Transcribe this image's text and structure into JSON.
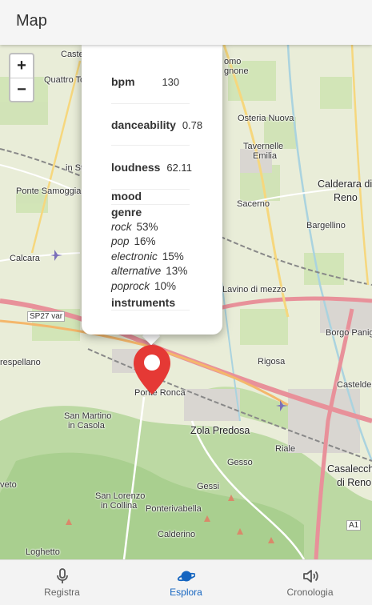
{
  "app_bar": {
    "title": "Map"
  },
  "map": {
    "zoom_in": "+",
    "zoom_out": "−",
    "places": [
      {
        "name": "Castel",
        "cls": ""
      },
      {
        "name": "Quattro To",
        "cls": ""
      },
      {
        "name": "in St",
        "cls": ""
      },
      {
        "name": "Ponte Samoggia",
        "cls": ""
      },
      {
        "name": "Calcara",
        "cls": ""
      },
      {
        "name": "SP27 var",
        "cls": ""
      },
      {
        "name": "respellano",
        "cls": ""
      },
      {
        "name": "Ponte Ronca",
        "cls": ""
      },
      {
        "name": "San Martino",
        "cls": ""
      },
      {
        "name": "in Casola",
        "cls": ""
      },
      {
        "name": "veto",
        "cls": ""
      },
      {
        "name": "San Lorenzo",
        "cls": ""
      },
      {
        "name": "in Collina",
        "cls": ""
      },
      {
        "name": "Ponterivabella",
        "cls": ""
      },
      {
        "name": "Calderino",
        "cls": ""
      },
      {
        "name": "Loghetto",
        "cls": ""
      },
      {
        "name": "Zola Predosa",
        "cls": "big"
      },
      {
        "name": "Gesso",
        "cls": ""
      },
      {
        "name": "Gessi",
        "cls": ""
      },
      {
        "name": "Riale",
        "cls": ""
      },
      {
        "name": "Casalecch",
        "cls": "big"
      },
      {
        "name": "di Reno",
        "cls": "big"
      },
      {
        "name": "A1",
        "cls": ""
      },
      {
        "name": "Rigosa",
        "cls": ""
      },
      {
        "name": "Lavino di mezzo",
        "cls": ""
      },
      {
        "name": "Sacerno",
        "cls": ""
      },
      {
        "name": "Tavernelle",
        "cls": ""
      },
      {
        "name": "Emilia",
        "cls": ""
      },
      {
        "name": "Osteria Nuova",
        "cls": ""
      },
      {
        "name": "omo",
        "cls": ""
      },
      {
        "name": "gnone",
        "cls": ""
      },
      {
        "name": "Calderara di",
        "cls": "big"
      },
      {
        "name": "Reno",
        "cls": "big"
      },
      {
        "name": "Bargellino",
        "cls": ""
      },
      {
        "name": "Borgo Panig",
        "cls": ""
      },
      {
        "name": "Casteldel",
        "cls": ""
      }
    ]
  },
  "popup": {
    "bpm": {
      "label": "bpm",
      "value": "130"
    },
    "danceability": {
      "label": "danceability",
      "value": "0.78"
    },
    "loudness": {
      "label": "loudness",
      "value": "62.11"
    },
    "mood": {
      "label": "mood"
    },
    "genre": {
      "label": "genre",
      "items": [
        {
          "name": "rock",
          "pct": "53%"
        },
        {
          "name": "pop",
          "pct": "16%"
        },
        {
          "name": "electronic",
          "pct": "15%"
        },
        {
          "name": "alternative",
          "pct": "13%"
        },
        {
          "name": "poprock",
          "pct": "10%"
        }
      ]
    },
    "instruments": {
      "label": "instruments"
    }
  },
  "nav": {
    "items": [
      {
        "label": "Registra",
        "icon": "microphone-icon",
        "active": false
      },
      {
        "label": "Esplora",
        "icon": "planet-icon",
        "active": true
      },
      {
        "label": "Cronologia",
        "icon": "speaker-icon",
        "active": false
      }
    ],
    "active_color": "#1565c0",
    "inactive_color": "#555555"
  },
  "colors": {
    "marker": "#e53935",
    "road_major": "#e8919a",
    "road_secondary": "#f4b76b",
    "forest": "#b8d8a0"
  }
}
